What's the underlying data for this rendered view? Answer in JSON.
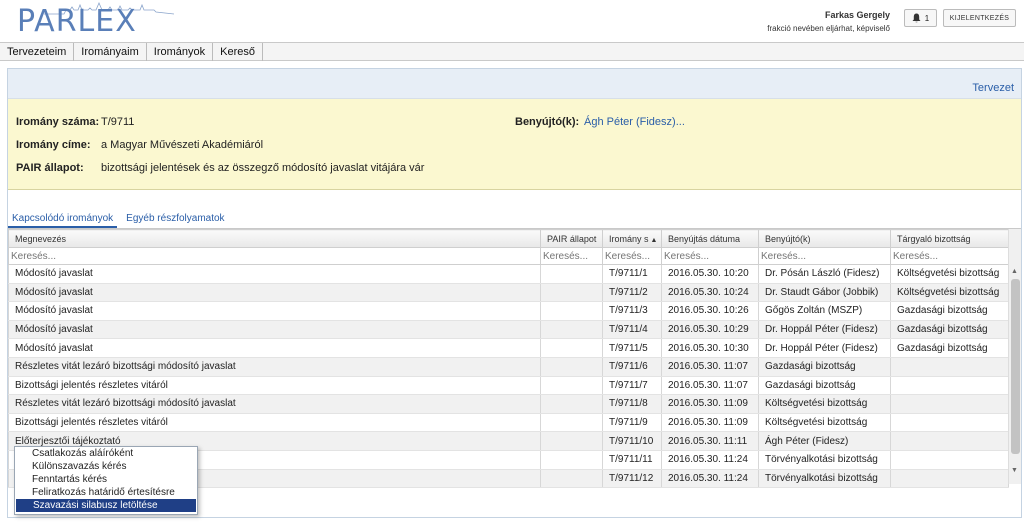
{
  "header": {
    "logo": "PARLEX",
    "user_name": "Farkas Gergely",
    "user_role": "frakció nevében eljárhat, képviselő",
    "notification_count": "1",
    "logout_label": "KIJELENTKEZÉS"
  },
  "menu": [
    "Tervezeteim",
    "Irományaim",
    "Irományok",
    "Kereső"
  ],
  "panel": {
    "tervezet_link": "Tervezet",
    "fields": {
      "szam_label": "Iromány száma:",
      "szam_value": "T/9711",
      "cim_label": "Iromány címe:",
      "cim_value": "a Magyar Művészeti Akadémiáról",
      "pair_label": "PAIR állapot:",
      "pair_value": "bizottsági jelentések és az összegző módosító javaslat vitájára vár",
      "benyujto_label": "Benyújtó(k):",
      "benyujto_value": "Ágh Péter (Fidesz)..."
    }
  },
  "tabs": [
    "Kapcsolódó irományok",
    "Egyéb részfolyamatok"
  ],
  "table": {
    "columns": [
      "Megnevezés",
      "PAIR állapot",
      "Iromány s",
      "Benyújtás dátuma",
      "Benyújtó(k)",
      "Tárgyaló bizottság"
    ],
    "search_placeholder": "Keresés...",
    "rows": [
      [
        "Módosító javaslat",
        "",
        "T/9711/1",
        "2016.05.30. 10:20",
        "Dr. Pósán László (Fidesz)",
        "Költségvetési bizottság"
      ],
      [
        "Módosító javaslat",
        "",
        "T/9711/2",
        "2016.05.30. 10:24",
        "Dr. Staudt Gábor (Jobbik)",
        "Költségvetési bizottság"
      ],
      [
        "Módosító javaslat",
        "",
        "T/9711/3",
        "2016.05.30. 10:26",
        "Gőgös Zoltán (MSZP)",
        "Gazdasági bizottság"
      ],
      [
        "Módosító javaslat",
        "",
        "T/9711/4",
        "2016.05.30. 10:29",
        "Dr. Hoppál Péter (Fidesz)",
        "Gazdasági bizottság"
      ],
      [
        "Módosító javaslat",
        "",
        "T/9711/5",
        "2016.05.30. 10:30",
        "Dr. Hoppál Péter (Fidesz)",
        "Gazdasági bizottság"
      ],
      [
        "Részletes vitát lezáró bizottsági módosító javaslat",
        "",
        "T/9711/6",
        "2016.05.30. 11:07",
        "Gazdasági bizottság",
        ""
      ],
      [
        "Bizottsági jelentés részletes vitáról",
        "",
        "T/9711/7",
        "2016.05.30. 11:07",
        "Gazdasági bizottság",
        ""
      ],
      [
        "Részletes vitát lezáró bizottsági módosító javaslat",
        "",
        "T/9711/8",
        "2016.05.30. 11:09",
        "Költségvetési bizottság",
        ""
      ],
      [
        "Bizottsági jelentés részletes vitáról",
        "",
        "T/9711/9",
        "2016.05.30. 11:09",
        "Költségvetési bizottság",
        ""
      ],
      [
        "Előterjesztői tájékoztató",
        "",
        "T/9711/10",
        "2016.05.30. 11:11",
        "Ágh Péter (Fidesz)",
        ""
      ],
      [
        "",
        "",
        "T/9711/11",
        "2016.05.30. 11:24",
        "Törvényalkotási bizottság",
        ""
      ],
      [
        "",
        "",
        "T/9711/12",
        "2016.05.30. 11:24",
        "Törvényalkotási bizottság",
        ""
      ]
    ]
  },
  "popup": {
    "items": [
      "Csatlakozás aláíróként",
      "Különszavazás kérés",
      "Fenntartás kérés",
      "Feliratkozás határidő értesítésre",
      "Szavazási silabusz letöltése"
    ],
    "selected_index": 4
  },
  "colors": {
    "brand": "#5a7fb8",
    "link": "#2a5ea8",
    "info_bg": "#fbf8d0",
    "selection": "#1f3f86"
  }
}
